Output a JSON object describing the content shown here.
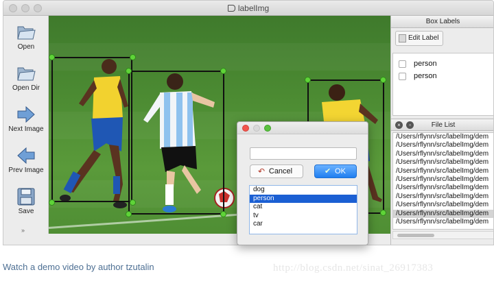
{
  "window": {
    "title": "labelImg"
  },
  "toolbar": {
    "items": [
      {
        "label": "Open",
        "icon": "folder-open-icon"
      },
      {
        "label": "Open Dir",
        "icon": "folder-open-icon"
      },
      {
        "label": "Next Image",
        "icon": "arrow-right-icon"
      },
      {
        "label": "Prev Image",
        "icon": "arrow-left-icon"
      },
      {
        "label": "Save",
        "icon": "floppy-disk-icon"
      }
    ],
    "more": "»"
  },
  "box_labels": {
    "title": "Box Labels",
    "edit_label": "Edit Label",
    "items": [
      "person",
      "person"
    ]
  },
  "file_list": {
    "title": "File List",
    "files": [
      "/Users/rflynn/src/labelImg/dem",
      "/Users/rflynn/src/labelImg/dem",
      "/Users/rflynn/src/labelImg/dem",
      "/Users/rflynn/src/labelImg/dem",
      "/Users/rflynn/src/labelImg/dem",
      "/Users/rflynn/src/labelImg/dem",
      "/Users/rflynn/src/labelImg/dem",
      "/Users/rflynn/src/labelImg/dem",
      "/Users/rflynn/src/labelImg/dem",
      "/Users/rflynn/src/labelImg/dem",
      "/Users/rflynn/src/labelImg/dem"
    ],
    "selected_index": 9
  },
  "dialog": {
    "input_value": "",
    "cancel": "Cancel",
    "ok": "OK",
    "options": [
      "dog",
      "person",
      "cat",
      "tv",
      "car"
    ],
    "selected_index": 1
  },
  "footer": {
    "link": "Watch a demo video by author tzutalin",
    "watermark": "http://blog.csdn.net/sinat_26917383"
  },
  "colors": {
    "point": "#5fd438",
    "box": "#101010",
    "ok_button": "#1f7ef0",
    "selection": "#1b5fd3"
  }
}
